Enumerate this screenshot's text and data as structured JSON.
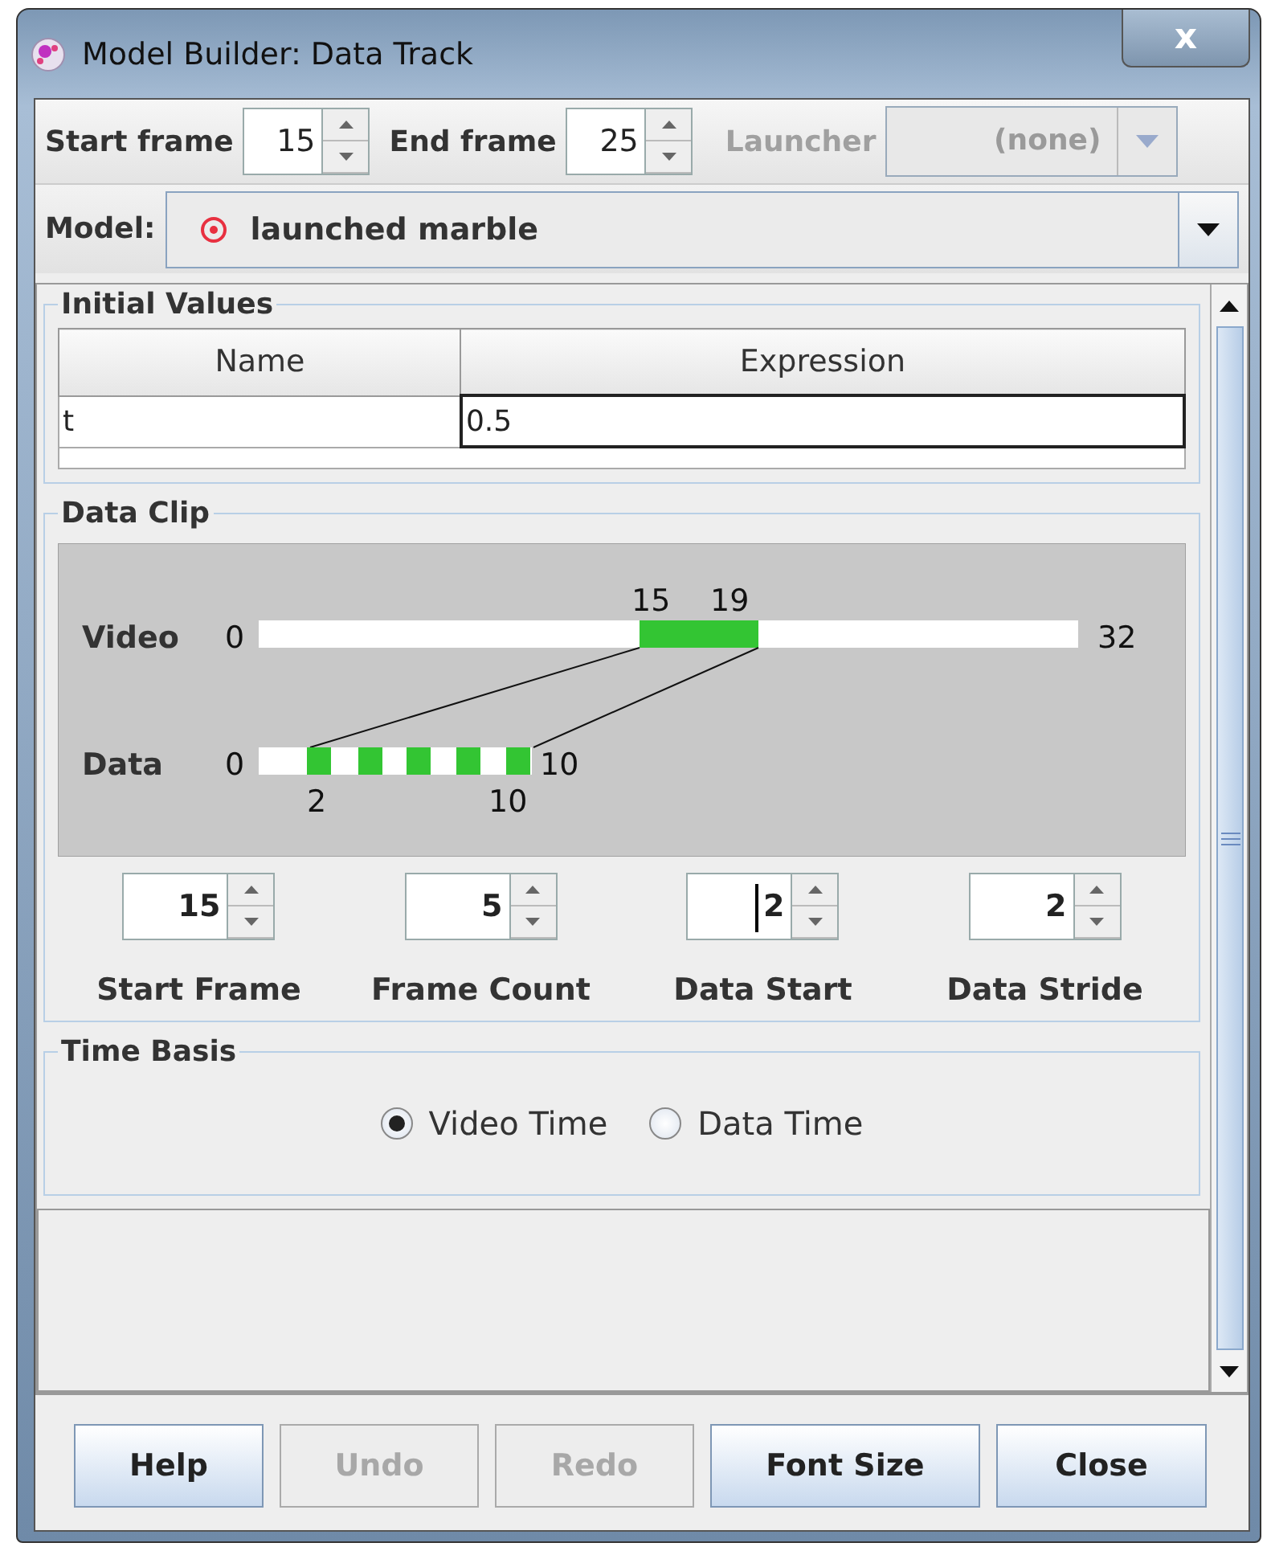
{
  "window": {
    "title": "Model Builder: Data Track",
    "close": "x"
  },
  "toolbar": {
    "spinners": [
      {
        "label": "Start frame",
        "value": "15"
      },
      {
        "label": "End frame",
        "value": "25"
      }
    ],
    "launcher": {
      "label": "Launcher",
      "value": "(none)",
      "disabled": true
    }
  },
  "model": {
    "label": "Model:",
    "value": "launched marble"
  },
  "initial_values": {
    "title": "Initial Values",
    "columns": [
      "Name",
      "Expression"
    ],
    "rows": [
      [
        "t",
        "0.5"
      ]
    ]
  },
  "data_clip": {
    "title": "Data Clip",
    "diagram": {
      "video_label": "Video",
      "video_start": "0",
      "video_end": "32",
      "clip_start": "15",
      "clip_end": "19",
      "data_label": "Data",
      "data_start": "0",
      "data_end": "10",
      "data_first": "2",
      "data_last": "10"
    },
    "spinners": [
      {
        "label": "Start Frame",
        "value": "15"
      },
      {
        "label": "Frame Count",
        "value": "5"
      },
      {
        "label": "Data Start",
        "value": "2",
        "focused": true
      },
      {
        "label": "Data Stride",
        "value": "2"
      }
    ]
  },
  "time_basis": {
    "title": "Time Basis",
    "options": [
      {
        "label": "Video Time",
        "selected": true
      },
      {
        "label": "Data Time",
        "selected": false
      }
    ]
  },
  "buttons": [
    {
      "label": "Help",
      "disabled": false
    },
    {
      "label": "Undo",
      "disabled": true
    },
    {
      "label": "Redo",
      "disabled": true
    },
    {
      "label": "Font Size",
      "disabled": false
    },
    {
      "label": "Close",
      "disabled": false
    }
  ]
}
